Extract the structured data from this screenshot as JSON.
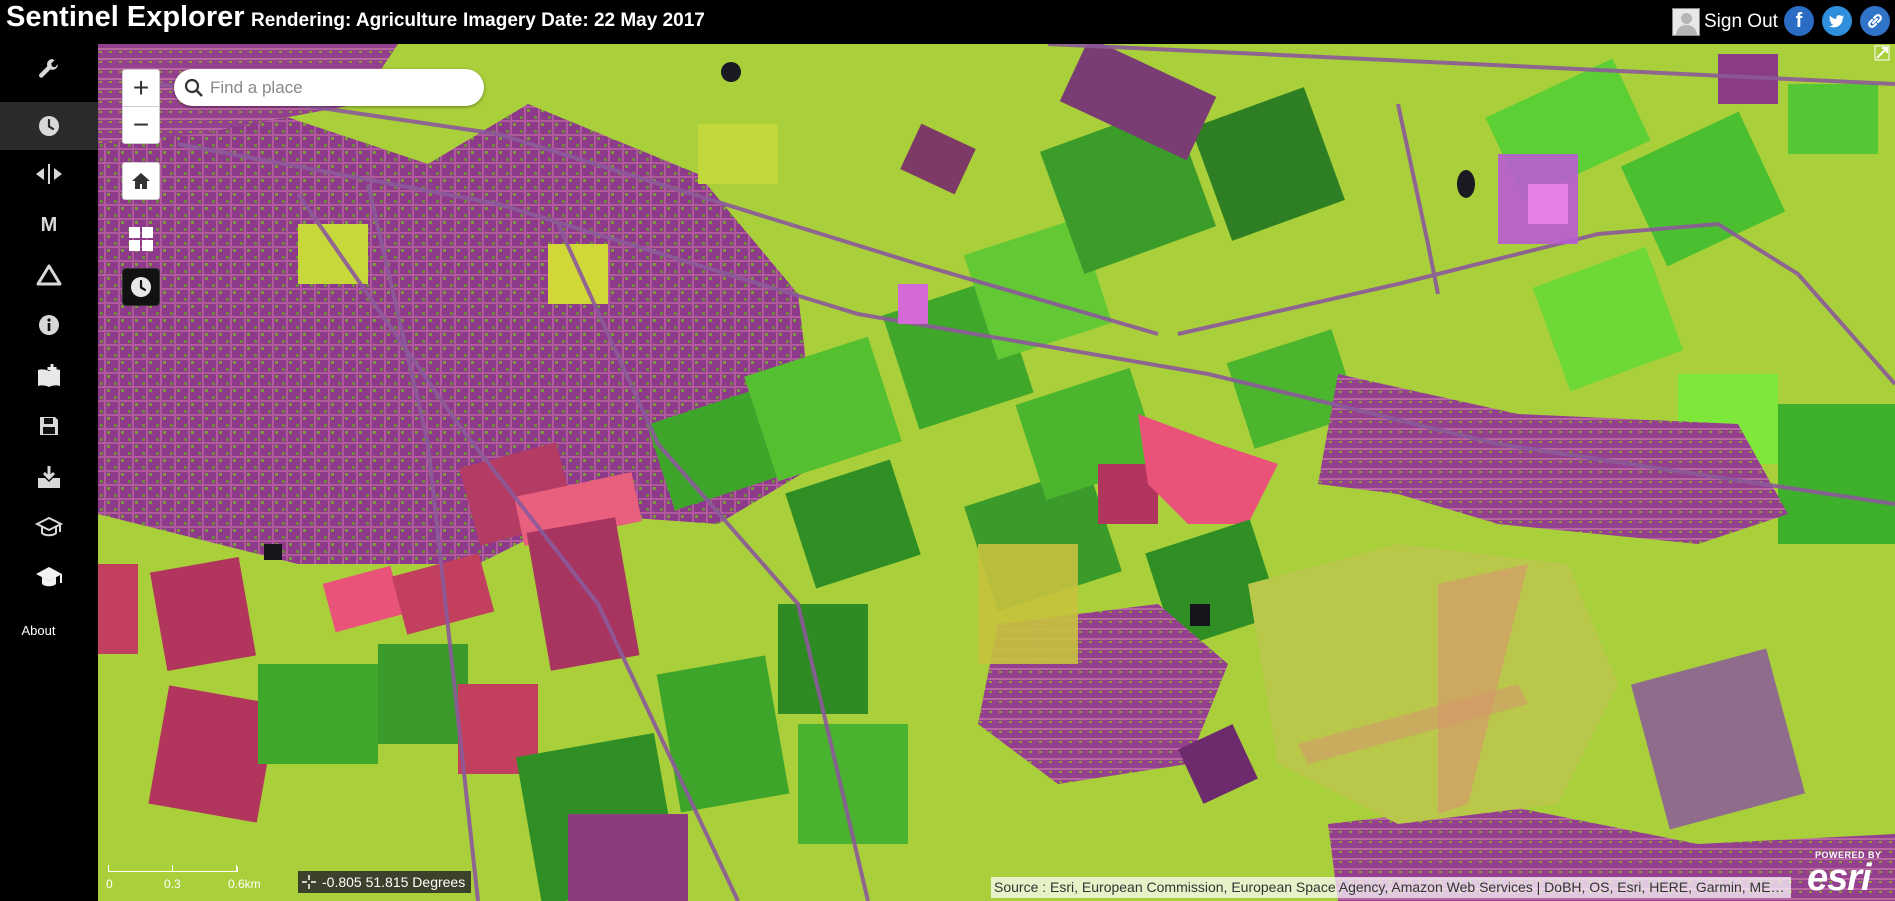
{
  "header": {
    "app_title": "Sentinel Explorer",
    "rendering": "Rendering: Agriculture",
    "imagery_date": "Imagery Date: 22 May 2017",
    "sign_out": "Sign Out",
    "social_icons": [
      "facebook-icon",
      "twitter-icon",
      "link-icon"
    ]
  },
  "sidebar": {
    "items": [
      {
        "icon": "wrench-icon"
      },
      {
        "icon": "clock-icon",
        "active": true
      },
      {
        "icon": "swipe-icon"
      },
      {
        "icon": "m-icon",
        "glyph": "M"
      },
      {
        "icon": "triangle-icon"
      },
      {
        "icon": "info-icon"
      },
      {
        "icon": "bookmark-add-icon"
      },
      {
        "icon": "save-icon"
      },
      {
        "icon": "download-icon"
      },
      {
        "icon": "graduation-cap-outline-icon"
      },
      {
        "icon": "graduation-cap-icon"
      }
    ],
    "about_label": "About"
  },
  "map": {
    "zoom_in": "+",
    "zoom_out": "−",
    "search_placeholder": "Find a place",
    "scale": {
      "labels": [
        "0",
        "0.3",
        "0.6km"
      ]
    },
    "coordinates": "-0.805 51.815 Degrees",
    "attribution": "Source : Esri, European Commission, European Space Agency, Amazon Web Services | DoBH, OS, Esri, HERE, Garmin, METI/NASA, USGS",
    "logo": {
      "powered_by": "POWERED BY",
      "word": "esri"
    }
  },
  "colors": {
    "vegetation_bright": "#7ee83a",
    "vegetation_dark": "#3fa82a",
    "urban": "#8e3a8a",
    "bare_soil": "#c2405e",
    "pink_field": "#e9537a",
    "crop_yellow": "#c7d93a",
    "social_blue": "#2b6cc4"
  }
}
